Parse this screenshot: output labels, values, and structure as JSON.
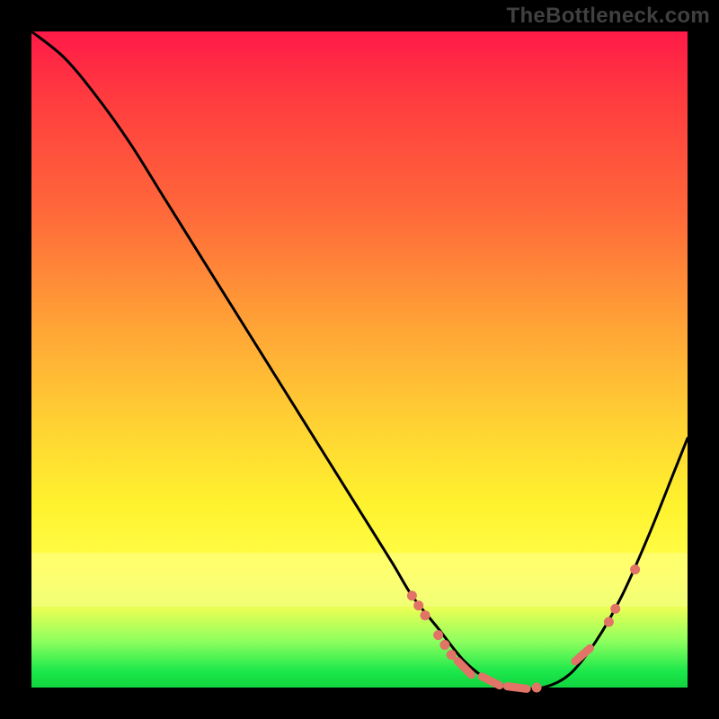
{
  "watermark": "TheBottleneck.com",
  "colors": {
    "bead": "#e17367",
    "curve": "#000000",
    "background": "#000000"
  },
  "chart_data": {
    "type": "line",
    "title": "",
    "xlabel": "",
    "ylabel": "",
    "xlim": [
      0,
      100
    ],
    "ylim": [
      0,
      100
    ],
    "grid": false,
    "series": [
      {
        "name": "bottleneck-curve",
        "x": [
          0,
          5,
          10,
          15,
          20,
          25,
          30,
          35,
          40,
          45,
          50,
          55,
          58,
          62,
          66,
          70,
          74,
          78,
          82,
          86,
          90,
          94,
          98,
          100
        ],
        "y": [
          100,
          96,
          90,
          83,
          75,
          67,
          59,
          51,
          43,
          35,
          27,
          19,
          14,
          9,
          4,
          1,
          0,
          0,
          2,
          7,
          14,
          23,
          33,
          38
        ]
      }
    ],
    "annotations": {
      "beads": [
        {
          "x": 58,
          "y": 14,
          "type": "dot"
        },
        {
          "x": 59,
          "y": 12.5,
          "type": "dot"
        },
        {
          "x": 60,
          "y": 11,
          "type": "dot"
        },
        {
          "x": 62,
          "y": 8,
          "type": "dot"
        },
        {
          "x": 63,
          "y": 6.5,
          "type": "dot"
        },
        {
          "x": 64,
          "y": 5,
          "type": "dot"
        },
        {
          "x": 66,
          "y": 3,
          "type": "dash"
        },
        {
          "x": 70,
          "y": 1,
          "type": "dash"
        },
        {
          "x": 74,
          "y": 0,
          "type": "dash"
        },
        {
          "x": 77,
          "y": 0,
          "type": "dot"
        },
        {
          "x": 84,
          "y": 5,
          "type": "dash"
        },
        {
          "x": 88,
          "y": 10,
          "type": "dot"
        },
        {
          "x": 89,
          "y": 12,
          "type": "dot"
        },
        {
          "x": 92,
          "y": 18,
          "type": "dot"
        }
      ]
    }
  }
}
